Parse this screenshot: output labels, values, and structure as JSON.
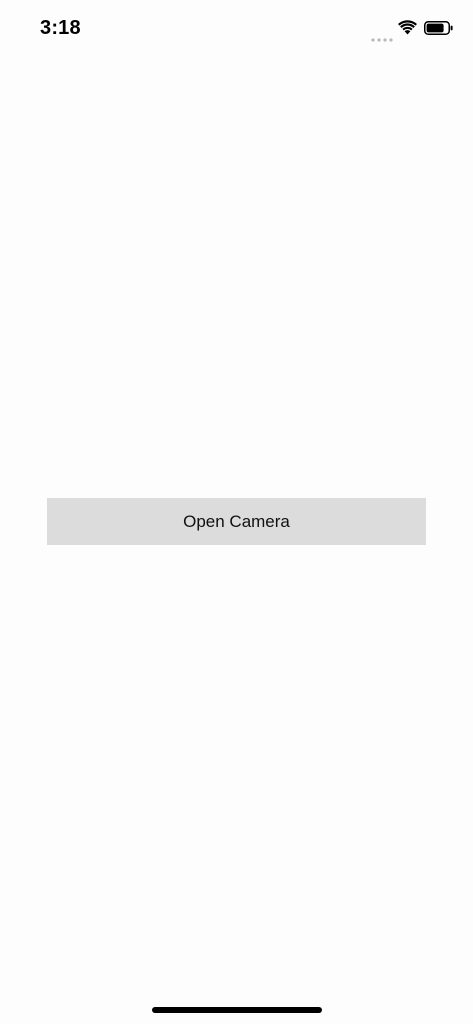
{
  "status_bar": {
    "time": "3:18",
    "signal_icon": "signal-dots-icon",
    "wifi_icon": "wifi-icon",
    "battery_icon": "battery-icon"
  },
  "main": {
    "open_camera_label": "Open Camera"
  },
  "colors": {
    "background": "#fdfdfd",
    "button_background": "#dcdcdc",
    "text": "#111111"
  }
}
